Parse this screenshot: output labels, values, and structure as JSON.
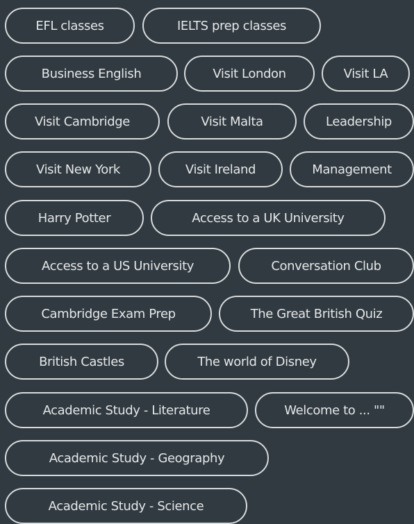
{
  "tags": [
    "EFL classes",
    "IELTS prep classes",
    "Business English",
    "Visit London",
    "Visit LA",
    "Visit Cambridge",
    "Visit Malta",
    "Leadership",
    "Visit New York",
    "Visit Ireland",
    "Management",
    "Harry Potter",
    "Access to a UK University",
    "Access to a US University",
    "Conversation Club",
    "Cambridge Exam Prep",
    "The Great British Quiz",
    "British Castles",
    "The world of Disney",
    "Academic Study - Literature",
    "Welcome to ... \"\"",
    "Academic Study - Geography",
    "Academic Study - Science"
  ]
}
